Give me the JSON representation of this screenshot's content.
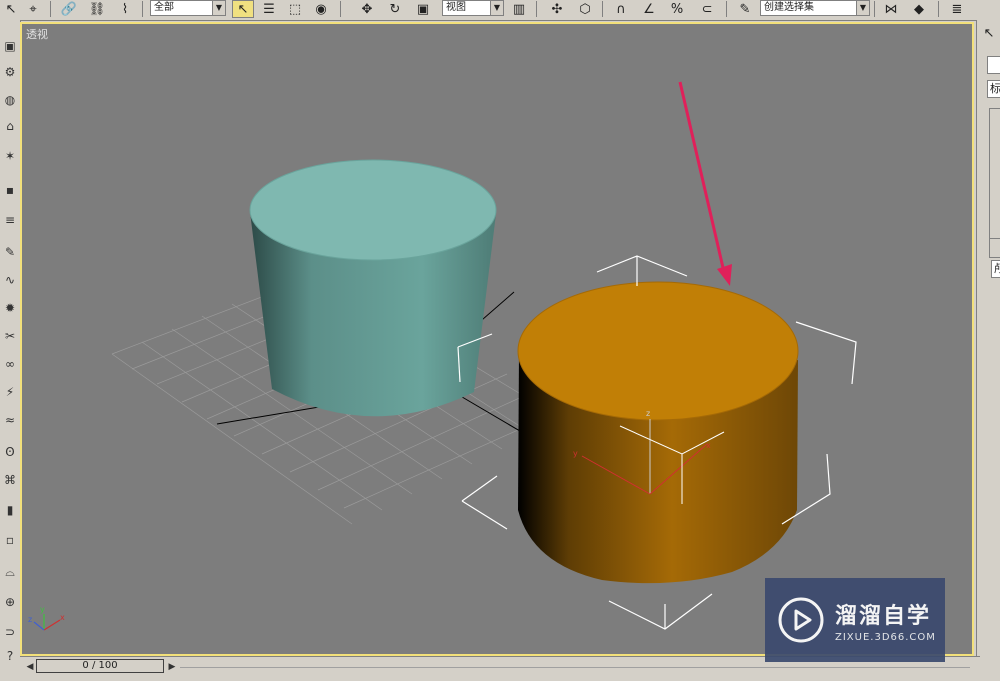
{
  "toolbar": {
    "selection_filter": "全部",
    "reference_coord": "视图",
    "named_selection": "创建选择集"
  },
  "viewport": {
    "label": "透视",
    "axis_gizmo_labels": {
      "x": "x",
      "y": "y",
      "z": "z"
    }
  },
  "scene": {
    "cylinder1_color": "#7fb8b0",
    "cylinder2_color": "#c17f06",
    "arrow_color": "#e0205a",
    "selection_color": "#ffffff",
    "pivot_labels": {
      "z": "z",
      "y": "y",
      "x": "x"
    }
  },
  "right_panel": {
    "tab_label": "标",
    "field_label": "颅"
  },
  "timeline": {
    "frame_display": "0 / 100"
  },
  "watermark": {
    "title": "溜溜自学",
    "url": "ZIXUE.3D66.COM",
    "bg_color": "#3b4a6e"
  }
}
